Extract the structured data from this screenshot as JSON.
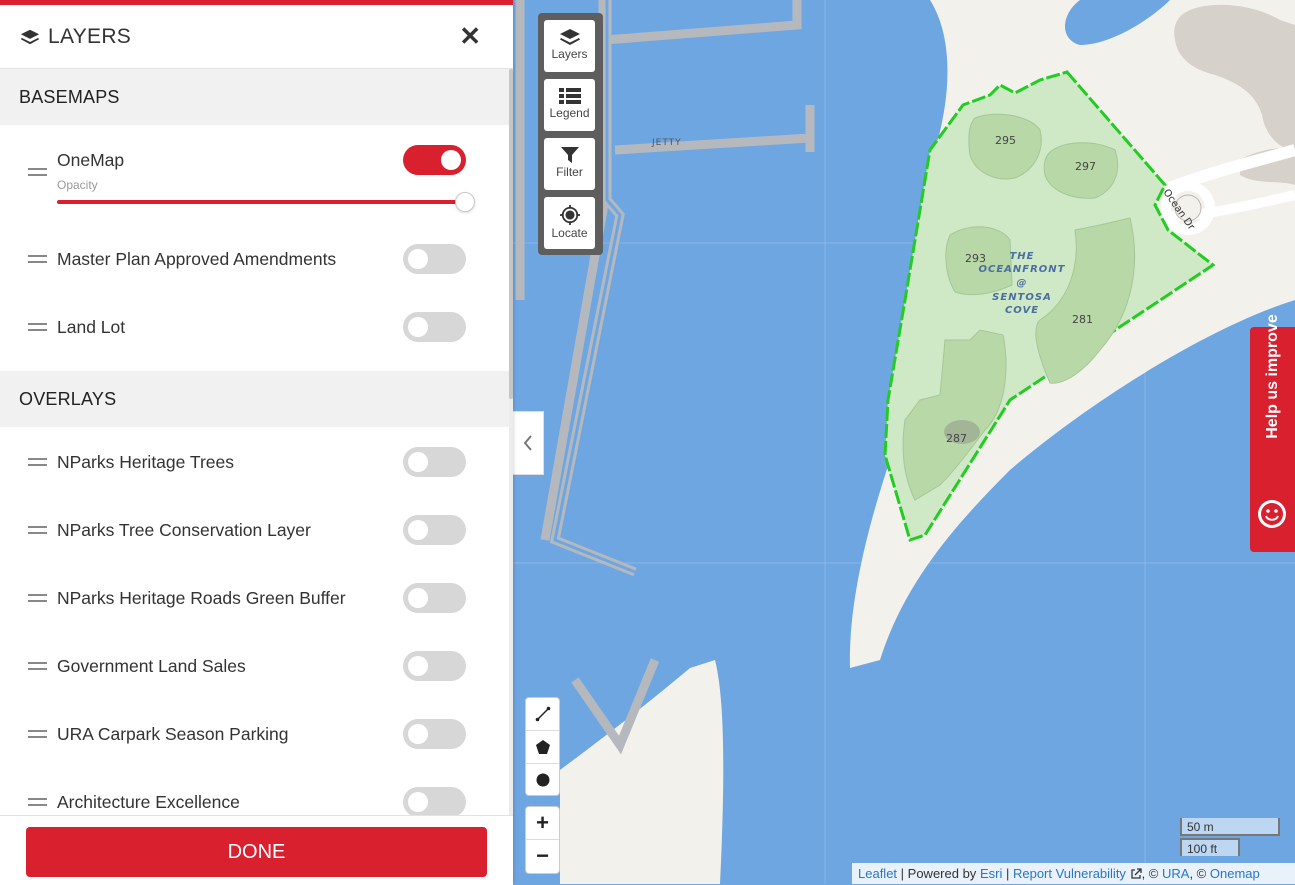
{
  "panel": {
    "title": "LAYERS",
    "close_icon": "close-icon",
    "basemaps": {
      "heading": "BASEMAPS",
      "opacity_label": "Opacity",
      "opacity_value": 1.0,
      "items": [
        {
          "label": "OneMap",
          "enabled": true
        },
        {
          "label": "Master Plan Approved Amendments",
          "enabled": false
        },
        {
          "label": "Land Lot",
          "enabled": false
        }
      ]
    },
    "overlays": {
      "heading": "OVERLAYS",
      "items": [
        {
          "label": "NParks Heritage Trees",
          "enabled": false
        },
        {
          "label": "NParks Tree Conservation Layer",
          "enabled": false
        },
        {
          "label": "NParks Heritage Roads Green Buffer",
          "enabled": false
        },
        {
          "label": "Government Land Sales",
          "enabled": false
        },
        {
          "label": "URA Carpark Season Parking",
          "enabled": false
        },
        {
          "label": "Architecture Excellence",
          "enabled": false
        }
      ]
    },
    "done_label": "DONE"
  },
  "toolbox": {
    "layers": "Layers",
    "legend": "Legend",
    "filter": "Filter",
    "locate": "Locate"
  },
  "map": {
    "jetty": "JETTY",
    "road": "Ocean Dr",
    "estate": [
      "THE",
      "OCEANFRONT",
      "@",
      "SENTOSA",
      "COVE"
    ],
    "blocks": [
      "295",
      "297",
      "293",
      "281",
      "287"
    ],
    "colors": {
      "water": "#6ea6e2",
      "land": "#f3f1ec",
      "highlight": "#22cc22",
      "accent": "#d9202f"
    }
  },
  "zoom": {
    "in": "+",
    "out": "−"
  },
  "feedback": "Help us improve",
  "scale": {
    "metric": "50 m",
    "imperial": "100 ft"
  },
  "attribution": {
    "leaflet": "Leaflet",
    "powered": "| Powered by",
    "esri": "Esri",
    "sep": "|",
    "report": "Report Vulnerability",
    "copy1": ", ©",
    "ura": "URA",
    "copy2": ", ©",
    "onemap": "Onemap"
  }
}
